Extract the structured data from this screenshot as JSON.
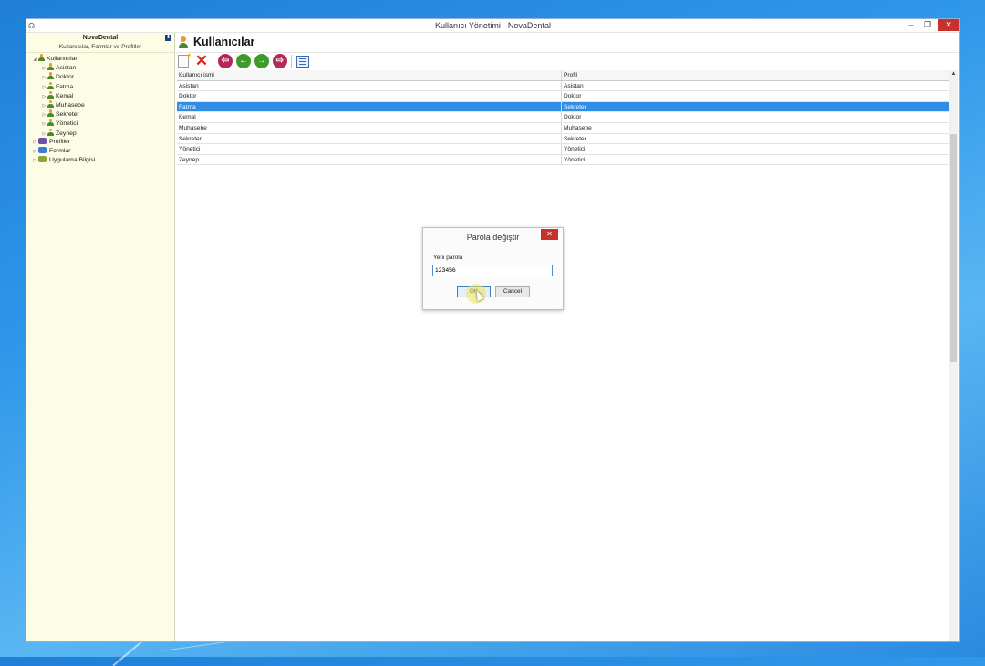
{
  "window": {
    "title": "Kullanıcı Yönetimi - NovaDental"
  },
  "sidebar": {
    "brand": "NovaDental",
    "subtitle": "Kullanıcılar, Formlar ve Profiller",
    "root": "Kullanıcılar",
    "users": [
      "Asistan",
      "Doktor",
      "Fatma",
      "Kemal",
      "Muhasebe",
      "Sekreter",
      "Yönetici",
      "Zeynep"
    ],
    "groups": [
      "Profiller",
      "Formlar",
      "Uygulama Bilgisi"
    ]
  },
  "main": {
    "title": "Kullanıcılar"
  },
  "grid": {
    "headers": [
      "Kullanıcı ismi",
      "Profil"
    ],
    "rows": [
      [
        "Asistan",
        "Asistan"
      ],
      [
        "Doktor",
        "Doktor"
      ],
      [
        "Fatma",
        "Sekreter"
      ],
      [
        "Kemal",
        "Doktor"
      ],
      [
        "Muhasebe",
        "Muhasebe"
      ],
      [
        "Sekreter",
        "Sekreter"
      ],
      [
        "Yönetici",
        "Yönetici"
      ],
      [
        "Zeynep",
        "Yönetici"
      ]
    ],
    "selected_index": 2
  },
  "dialog": {
    "title": "Parola değiştir",
    "label": "Yeni parola",
    "value": "123456",
    "ok": "OK",
    "cancel": "Cancel"
  },
  "colors": {
    "selection": "#2f8de4",
    "sidebar_bg": "#fdfce4",
    "close": "#c9302c"
  }
}
